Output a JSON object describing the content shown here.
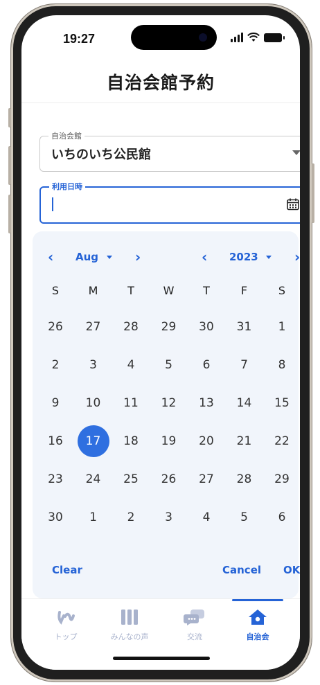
{
  "status": {
    "time": "19:27"
  },
  "header": {
    "title": "自治会館予約"
  },
  "form": {
    "hall_label": "自治会館",
    "hall_value": "いちのいち公民館",
    "datetime_label": "利用日時",
    "datetime_value": ""
  },
  "picker": {
    "month": "Aug",
    "year": "2023",
    "weekdays": [
      "S",
      "M",
      "T",
      "W",
      "T",
      "F",
      "S"
    ],
    "weeks": [
      [
        "26",
        "27",
        "28",
        "29",
        "30",
        "31",
        "1"
      ],
      [
        "2",
        "3",
        "4",
        "5",
        "6",
        "7",
        "8"
      ],
      [
        "9",
        "10",
        "11",
        "12",
        "13",
        "14",
        "15"
      ],
      [
        "16",
        "17",
        "18",
        "19",
        "20",
        "21",
        "22"
      ],
      [
        "23",
        "24",
        "25",
        "26",
        "27",
        "28",
        "29"
      ],
      [
        "30",
        "1",
        "2",
        "3",
        "4",
        "5",
        "6"
      ]
    ],
    "selected_day": "17",
    "clear_label": "Clear",
    "cancel_label": "Cancel",
    "ok_label": "OK"
  },
  "tabs": [
    {
      "label": "トップ",
      "icon": "top-logo-icon",
      "active": false
    },
    {
      "label": "みんなの声",
      "icon": "voices-icon",
      "active": false
    },
    {
      "label": "交流",
      "icon": "chat-bubble-icon",
      "active": false
    },
    {
      "label": "自治会",
      "icon": "home-icon",
      "active": true
    }
  ],
  "colors": {
    "accent": "#2563d6",
    "selected": "#2f6fe0",
    "picker_bg": "#f1f5fb",
    "inactive_tab": "#a8b2cc"
  }
}
